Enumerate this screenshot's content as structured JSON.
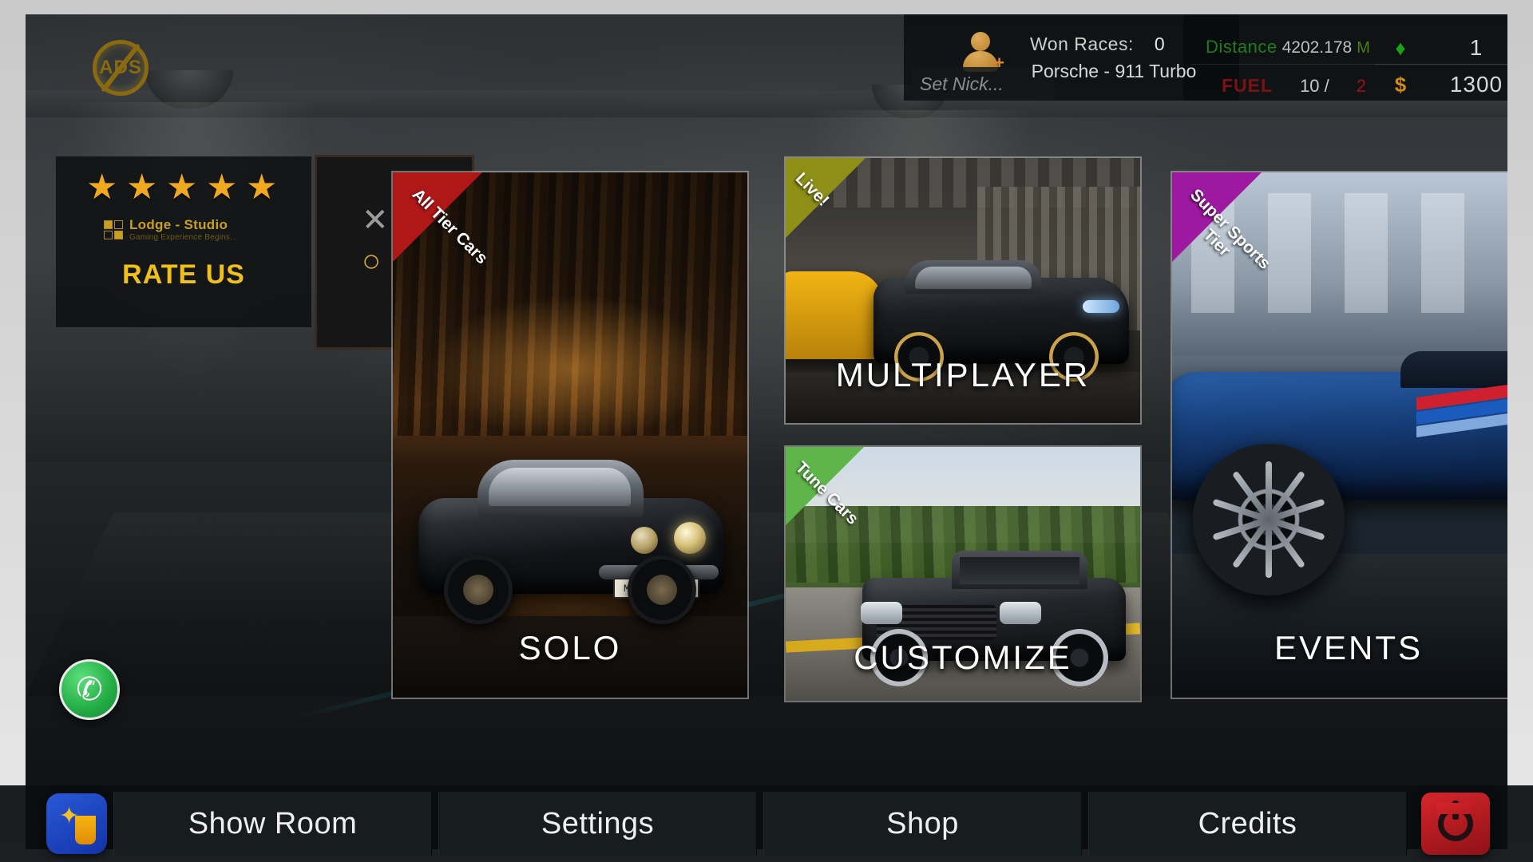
{
  "hud": {
    "ads_logo_text": "ADS",
    "nick_placeholder": "Set Nick...",
    "won_races_label": "Won Races:",
    "won_races_value": "0",
    "car_name": "Porsche - 911 Turbo",
    "distance_label": "Distance",
    "distance_value": "4202.178",
    "distance_unit": "M",
    "fuel_label": "FUEL",
    "fuel_value": "10 /",
    "fuel_max": "2",
    "gem_icon": "gem-icon",
    "gem_value": "1",
    "coin_icon": "dollar-icon",
    "coin_value": "1300",
    "profile_icon": "add-profile-icon"
  },
  "rate_panel": {
    "stars": 5,
    "star_glyph": "★",
    "studio_name": "Lodge - Studio",
    "studio_tagline": "Gaming Experience Begins...",
    "rate_us_label": "RATE US"
  },
  "ad_box": {
    "close_glyph": "✕",
    "alt_glyph": "○"
  },
  "cards": [
    {
      "id": "solo",
      "title": "SOLO",
      "ribbon": "All Tier Cars",
      "ribbon_color": "#b01717",
      "plate": "MTK•DP 52H"
    },
    {
      "id": "multiplayer",
      "title": "MULTIPLAYER",
      "ribbon": "Live!",
      "ribbon_color": "#8d8f17"
    },
    {
      "id": "customize",
      "title": "CUSTOMIZE",
      "ribbon": "Tune Cars",
      "ribbon_color": "#5fb54a"
    },
    {
      "id": "events",
      "title": "EVENTS",
      "ribbon": "Super Sports Tier",
      "ribbon_color": "#9c19a0"
    }
  ],
  "social": {
    "whatsapp_icon": "whatsapp-icon",
    "whatsapp_glyph": "✆"
  },
  "bottom_nav": {
    "app_icon": "app-logo-icon",
    "items": [
      {
        "label": "Show Room"
      },
      {
        "label": "Settings"
      },
      {
        "label": "Shop"
      },
      {
        "label": "Credits"
      }
    ],
    "power_icon": "power-icon"
  }
}
